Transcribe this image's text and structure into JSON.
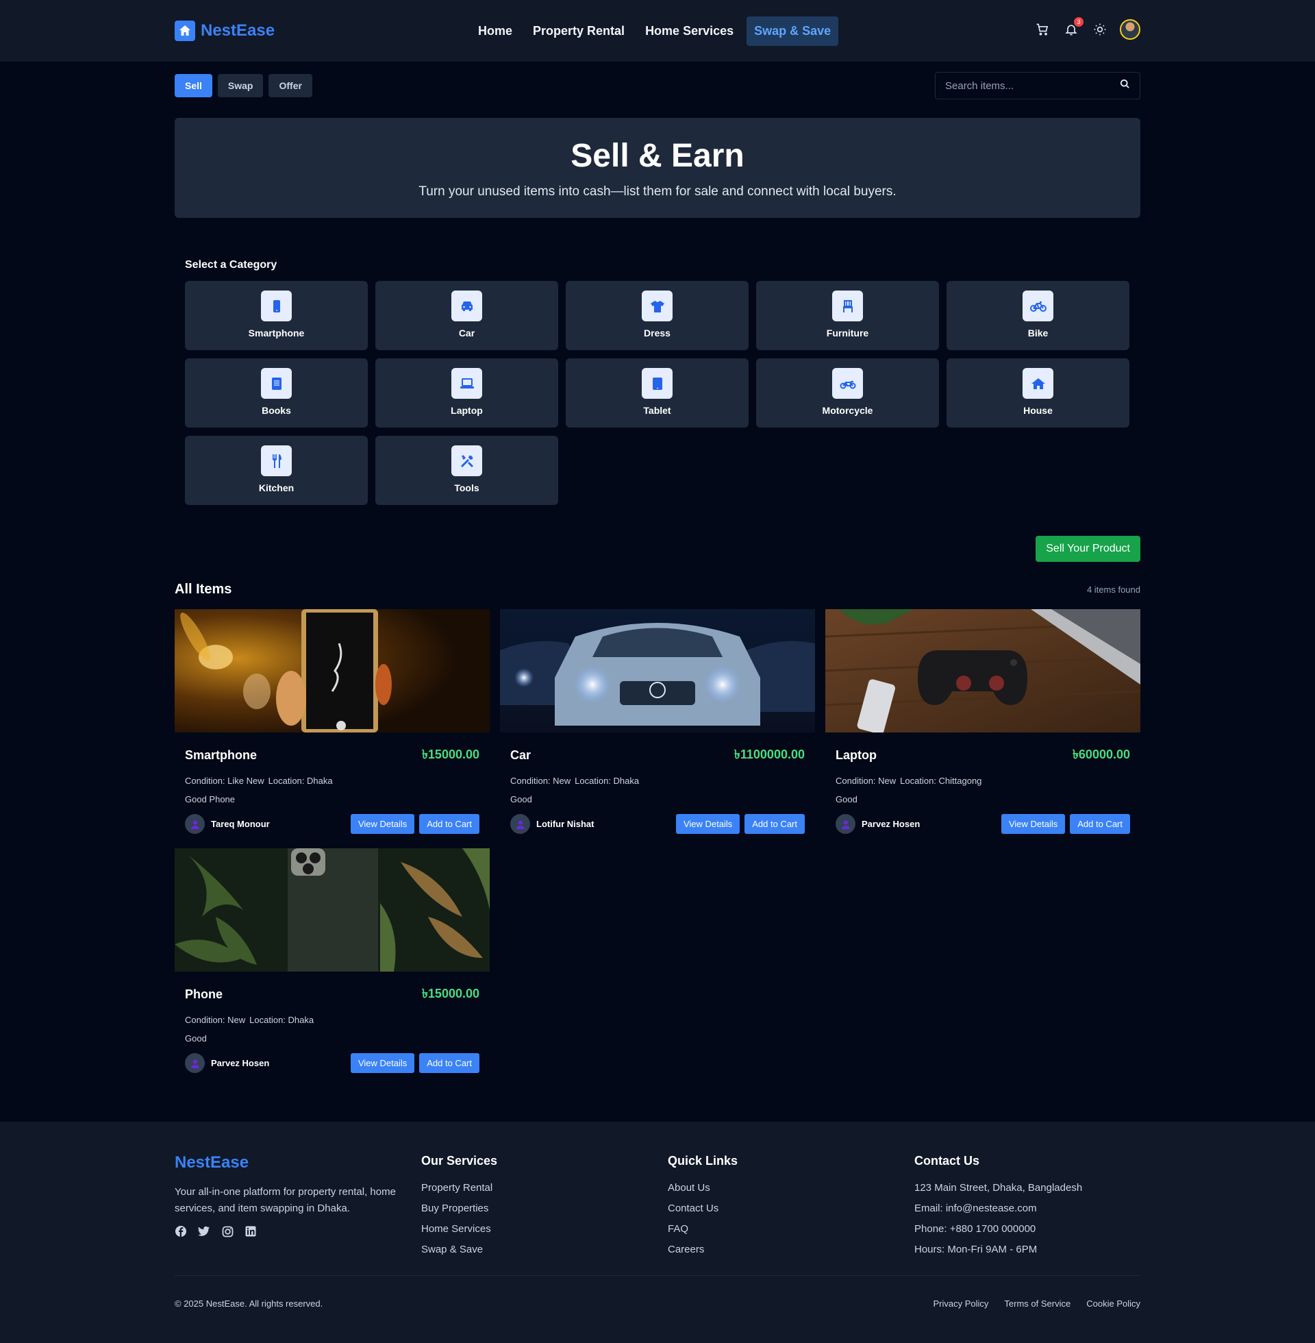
{
  "brand": {
    "name": "NestEase",
    "accent": "#3b82f6"
  },
  "nav": {
    "links": [
      "Home",
      "Property Rental",
      "Home Services",
      "Swap & Save"
    ],
    "active": "Swap & Save",
    "notification_count": "3"
  },
  "tabs": [
    "Sell",
    "Swap",
    "Offer"
  ],
  "search": {
    "placeholder": "Search items..."
  },
  "hero": {
    "title": "Sell & Earn",
    "subtitle": "Turn your unused items into cash—list them for sale and connect with local buyers."
  },
  "categories": {
    "heading": "Select a Category",
    "items": [
      {
        "label": "Smartphone",
        "icon": "smartphone-icon"
      },
      {
        "label": "Car",
        "icon": "car-icon"
      },
      {
        "label": "Dress",
        "icon": "shirt-icon"
      },
      {
        "label": "Furniture",
        "icon": "chair-icon"
      },
      {
        "label": "Bike",
        "icon": "bicycle-icon"
      },
      {
        "label": "Books",
        "icon": "book-icon"
      },
      {
        "label": "Laptop",
        "icon": "laptop-icon"
      },
      {
        "label": "Tablet",
        "icon": "tablet-icon"
      },
      {
        "label": "Motorcycle",
        "icon": "motorcycle-icon"
      },
      {
        "label": "House",
        "icon": "house-icon"
      },
      {
        "label": "Kitchen",
        "icon": "utensils-icon"
      },
      {
        "label": "Tools",
        "icon": "tools-icon"
      }
    ]
  },
  "sell_button": "Sell Your Product",
  "items": {
    "heading": "All Items",
    "count_text": "4 items found",
    "view_label": "View Details",
    "cart_label": "Add to Cart",
    "list": [
      {
        "name": "Smartphone",
        "price": "৳15000.00",
        "condition": "Condition: Like New",
        "location": "Location: Dhaka",
        "description": "Good Phone",
        "seller": "Tareq Monour"
      },
      {
        "name": "Car",
        "price": "৳1100000.00",
        "condition": "Condition: New",
        "location": "Location: Dhaka",
        "description": "Good",
        "seller": "Lotifur Nishat"
      },
      {
        "name": "Laptop",
        "price": "৳60000.00",
        "condition": "Condition: New",
        "location": "Location: Chittagong",
        "description": "Good",
        "seller": "Parvez Hosen"
      },
      {
        "name": "Phone",
        "price": "৳15000.00",
        "condition": "Condition: New",
        "location": "Location: Dhaka",
        "description": "Good",
        "seller": "Parvez Hosen"
      }
    ]
  },
  "footer": {
    "brand": "NestEase",
    "description": "Your all-in-one platform for property rental, home services, and item swapping in Dhaka.",
    "services": {
      "heading": "Our Services",
      "links": [
        "Property Rental",
        "Buy Properties",
        "Home Services",
        "Swap & Save"
      ]
    },
    "quick": {
      "heading": "Quick Links",
      "links": [
        "About Us",
        "Contact Us",
        "FAQ",
        "Careers"
      ]
    },
    "contact": {
      "heading": "Contact Us",
      "lines": [
        "123 Main Street, Dhaka, Bangladesh",
        "Email: info@nestease.com",
        "Phone: +880 1700 000000",
        "Hours: Mon-Fri 9AM - 6PM"
      ]
    },
    "copyright": "© 2025 NestEase. All rights reserved.",
    "policies": [
      "Privacy Policy",
      "Terms of Service",
      "Cookie Policy"
    ]
  }
}
